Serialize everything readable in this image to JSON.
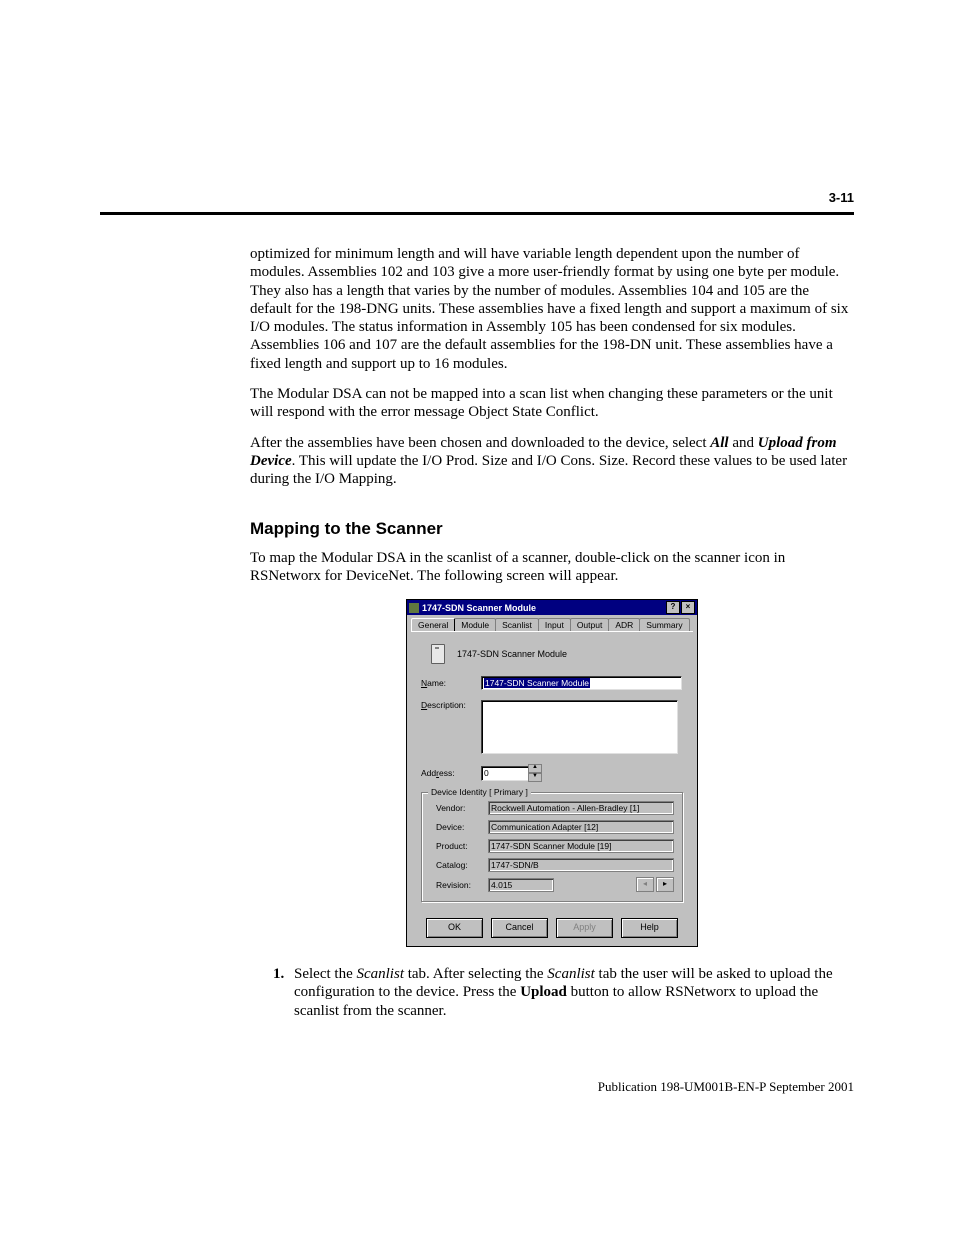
{
  "page_number": "3-11",
  "para1": {
    "text": "optimized for minimum length and will have variable length dependent upon the number of modules. Assemblies 102 and 103 give a more user-friendly format by using one byte per module. They also has a length that varies by the number of modules. Assemblies 104 and 105 are the default for the 198-DNG units. These assemblies have a fixed length and support a maximum of six I/O modules. The status information in Assembly 105 has been condensed for six modules. Assemblies 106 and 107 are the default assemblies for the 198-DN unit. These assemblies have a fixed length and support up to 16 modules."
  },
  "para2": {
    "text": "The Modular DSA can not be mapped into a scan list when changing these parameters or the unit will respond with the error message Object State Conflict."
  },
  "para3": {
    "lead": "After the assemblies have been chosen and downloaded to the device, select ",
    "bold1": "All",
    "mid": " and ",
    "bold2": "Upload from Device",
    "tail": ". This will update the I/O Prod. Size and I/O Cons. Size. Record these values to be used later during the I/O Mapping."
  },
  "heading": "Mapping to the Scanner",
  "para4": {
    "text": "To map the Modular DSA in the scanlist of a scanner, double-click on the scanner icon in RSNetworx for DeviceNet. The following screen will appear."
  },
  "dialog": {
    "title": "1747-SDN Scanner Module",
    "tabs": [
      "General",
      "Module",
      "Scanlist",
      "Input",
      "Output",
      "ADR",
      "Summary"
    ],
    "active_tab_index": 0,
    "module_line": "1747-SDN Scanner Module",
    "name_label": "Name:",
    "name_value": "1747-SDN Scanner Module",
    "desc_label": "Description:",
    "addr_label": "Address:",
    "addr_value": "0",
    "fieldset_legend": "Device Identity [ Primary ]",
    "identity": [
      {
        "label": "Vendor:",
        "value": "Rockwell Automation - Allen-Bradley [1]"
      },
      {
        "label": "Device:",
        "value": "Communication Adapter [12]"
      },
      {
        "label": "Product:",
        "value": "1747-SDN Scanner Module [19]"
      },
      {
        "label": "Catalog:",
        "value": "1747-SDN/B"
      },
      {
        "label": "Revision:",
        "value": "4.015"
      }
    ],
    "buttons": {
      "ok": "OK",
      "cancel": "Cancel",
      "apply": "Apply",
      "help": "Help"
    }
  },
  "step1": {
    "a": "Select the ",
    "i1": "Scanlist",
    "b": " tab. After selecting the ",
    "i2": "Scanlist",
    "c": " tab the user will be asked to upload the configuration to the device. Press the ",
    "bold": "Upload",
    "d": " button to allow RSNetworx to upload the scanlist from the scanner."
  },
  "footer": "Publication 198-UM001B-EN-P  September 2001"
}
